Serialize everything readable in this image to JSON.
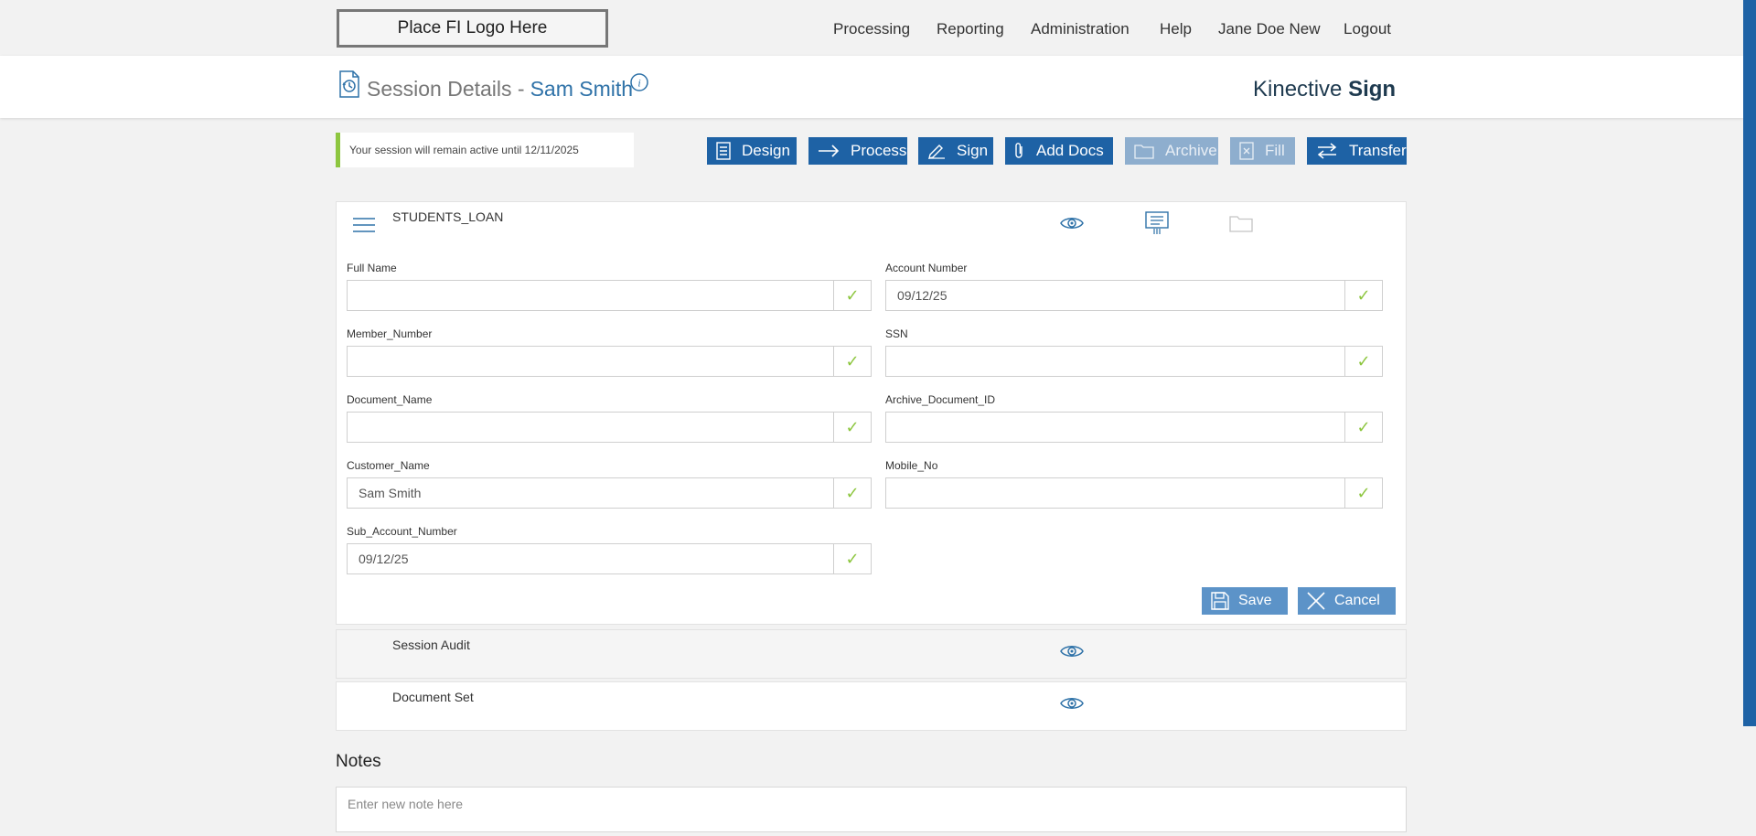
{
  "logo": {
    "text": "Place FI Logo Here"
  },
  "nav": {
    "processing": "Processing",
    "reporting": "Reporting",
    "administration": "Administration",
    "help": "Help",
    "user": "Jane Doe New",
    "logout": "Logout"
  },
  "session": {
    "title": "Session Details -",
    "customer": "Sam Smith",
    "brand_light": "Kinective",
    "brand_bold": "Sign"
  },
  "notice": "Your session will remain active until 12/11/2025",
  "toolbar": {
    "design": "Design",
    "process": "Process",
    "sign": "Sign",
    "add_docs": "Add Docs",
    "archive": "Archive",
    "fill": "Fill",
    "transfer": "Transfer"
  },
  "form": {
    "title": "STUDENTS_LOAN",
    "fields": [
      {
        "label": "Full Name",
        "value": ""
      },
      {
        "label": "Account Number",
        "value": "09/12/25"
      },
      {
        "label": "Member_Number",
        "value": ""
      },
      {
        "label": "SSN",
        "value": ""
      },
      {
        "label": "Document_Name",
        "value": ""
      },
      {
        "label": "Archive_Document_ID",
        "value": ""
      },
      {
        "label": "Customer_Name",
        "value": "Sam Smith"
      },
      {
        "label": "Mobile_No",
        "value": ""
      },
      {
        "label": "Sub_Account_Number",
        "value": "09/12/25"
      }
    ],
    "save": "Save",
    "cancel": "Cancel"
  },
  "panels": {
    "session_audit": "Session Audit",
    "document_set": "Document Set"
  },
  "notes": {
    "title": "Notes",
    "placeholder": "Enter new note here"
  },
  "colors": {
    "primary": "#1e62a5",
    "disabled": "#8eaece",
    "accent_green": "#8dc63f",
    "link_blue": "#2f72a8"
  }
}
